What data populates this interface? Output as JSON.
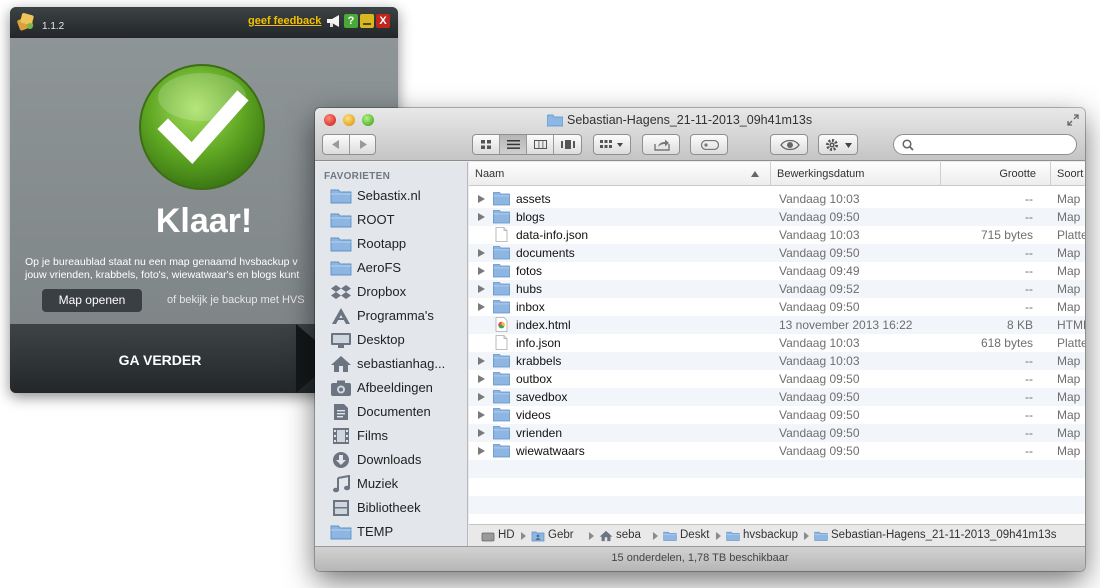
{
  "app": {
    "version": "1.1.2",
    "feedback_label": "geef feedback",
    "help_label": "?",
    "close_label": "X",
    "done_title": "Klaar!",
    "description_line1": "Op je bureaublad staat nu een map genaamd hvsbackup v",
    "description_line2": "jouw vrienden, krabbels, foto's, wiewatwaar's en blogs kunt",
    "open_map_label": "Map openen",
    "backup_link_text": "of bekijk je backup met HVS",
    "continue_label": "GA VERDER"
  },
  "finder": {
    "title": "Sebastian-Hagens_21-11-2013_09h41m13s",
    "sidebar": {
      "section_label": "FAVORIETEN",
      "items": [
        {
          "label": "Sebastix.nl",
          "icon": "folder-icon"
        },
        {
          "label": "ROOT",
          "icon": "folder-icon"
        },
        {
          "label": "Rootapp",
          "icon": "folder-icon"
        },
        {
          "label": "AeroFS",
          "icon": "folder-icon"
        },
        {
          "label": "Dropbox",
          "icon": "dropbox-icon"
        },
        {
          "label": "Programma's",
          "icon": "applications-icon"
        },
        {
          "label": "Desktop",
          "icon": "desktop-icon"
        },
        {
          "label": "sebastianhag...",
          "icon": "home-icon"
        },
        {
          "label": "Afbeeldingen",
          "icon": "camera-icon"
        },
        {
          "label": "Documenten",
          "icon": "documents-icon"
        },
        {
          "label": "Films",
          "icon": "film-icon"
        },
        {
          "label": "Downloads",
          "icon": "download-icon"
        },
        {
          "label": "Muziek",
          "icon": "music-icon"
        },
        {
          "label": "Bibliotheek",
          "icon": "library-icon"
        },
        {
          "label": "TEMP",
          "icon": "folder-icon"
        }
      ]
    },
    "columns": {
      "name": "Naam",
      "date": "Bewerkingsdatum",
      "size": "Grootte",
      "kind": "Soort"
    },
    "files": [
      {
        "name": "assets",
        "date": "Vandaag 10:03",
        "size": "--",
        "kind": "Map",
        "type": "folder"
      },
      {
        "name": "blogs",
        "date": "Vandaag 09:50",
        "size": "--",
        "kind": "Map",
        "type": "folder"
      },
      {
        "name": "data-info.json",
        "date": "Vandaag 10:03",
        "size": "715 bytes",
        "kind": "Platte",
        "type": "doc"
      },
      {
        "name": "documents",
        "date": "Vandaag 09:50",
        "size": "--",
        "kind": "Map",
        "type": "folder"
      },
      {
        "name": "fotos",
        "date": "Vandaag 09:49",
        "size": "--",
        "kind": "Map",
        "type": "folder"
      },
      {
        "name": "hubs",
        "date": "Vandaag 09:52",
        "size": "--",
        "kind": "Map",
        "type": "folder"
      },
      {
        "name": "inbox",
        "date": "Vandaag 09:50",
        "size": "--",
        "kind": "Map",
        "type": "folder"
      },
      {
        "name": "index.html",
        "date": "13 november 2013 16:22",
        "size": "8 KB",
        "kind": "HTML",
        "type": "html"
      },
      {
        "name": "info.json",
        "date": "Vandaag 10:03",
        "size": "618 bytes",
        "kind": "Platte",
        "type": "doc"
      },
      {
        "name": "krabbels",
        "date": "Vandaag 10:03",
        "size": "--",
        "kind": "Map",
        "type": "folder"
      },
      {
        "name": "outbox",
        "date": "Vandaag 09:50",
        "size": "--",
        "kind": "Map",
        "type": "folder"
      },
      {
        "name": "savedbox",
        "date": "Vandaag 09:50",
        "size": "--",
        "kind": "Map",
        "type": "folder"
      },
      {
        "name": "videos",
        "date": "Vandaag 09:50",
        "size": "--",
        "kind": "Map",
        "type": "folder"
      },
      {
        "name": "vrienden",
        "date": "Vandaag 09:50",
        "size": "--",
        "kind": "Map",
        "type": "folder"
      },
      {
        "name": "wiewatwaars",
        "date": "Vandaag 09:50",
        "size": "--",
        "kind": "Map",
        "type": "folder"
      }
    ],
    "path": [
      {
        "label": "HD",
        "icon": "hard-drive-icon"
      },
      {
        "label": "Gebr",
        "icon": "users-folder-icon"
      },
      {
        "label": "seba",
        "icon": "home-icon"
      },
      {
        "label": "Deskt",
        "icon": "folder-icon"
      },
      {
        "label": "hvsbackup",
        "icon": "folder-icon"
      },
      {
        "label": "Sebastian-Hagens_21-11-2013_09h41m13s",
        "icon": "folder-icon"
      }
    ],
    "status": "15 onderdelen, 1,78 TB beschikbaar"
  }
}
